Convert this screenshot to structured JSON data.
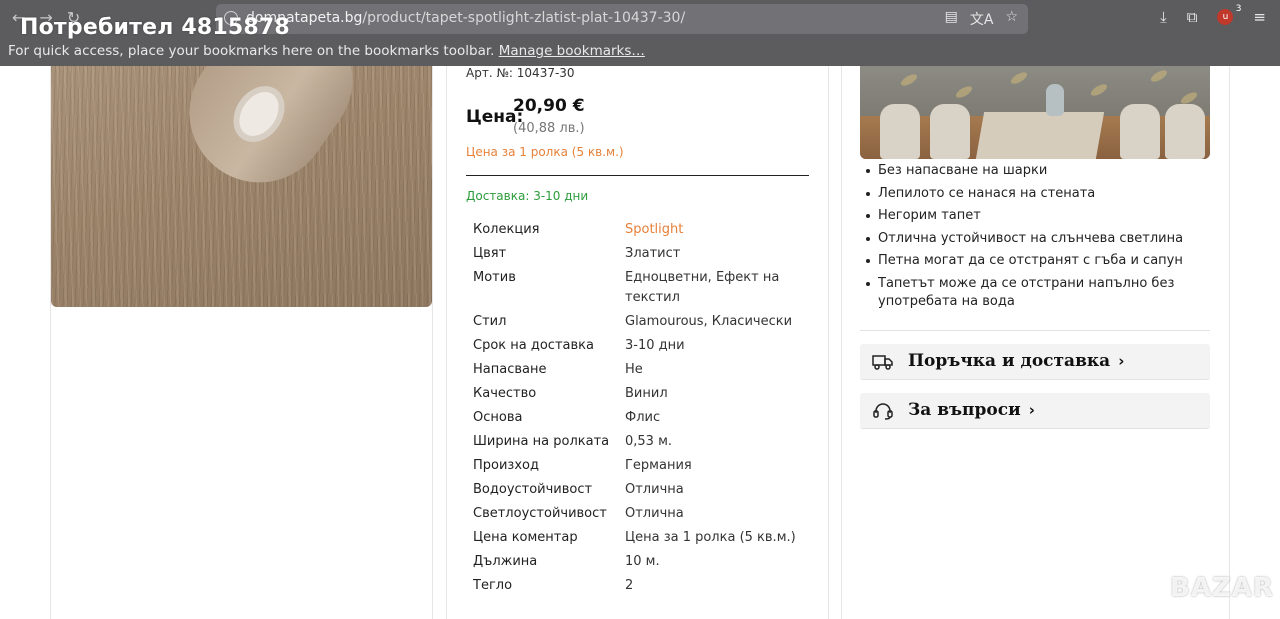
{
  "browser": {
    "user_overlay": "Потребител 4815878",
    "url_domain": "domnatapeta.bg",
    "url_path": "/product/tapet-spotlight-zlatist-plat-10437-30/",
    "bookmarks_hint": "For quick access, place your bookmarks here on the bookmarks toolbar.",
    "bookmarks_link": "Manage bookmarks…",
    "extension_count": "3"
  },
  "product": {
    "art_no": "Арт. №: 10437-30",
    "price_label": "Цена:",
    "price_eur": "20,90 €",
    "price_bgn": "(40,88 лв.)",
    "price_note": "Цена за 1 ролка (5 кв.м.)",
    "delivery": "Доставка: 3-10 дни",
    "specs": [
      {
        "key": "Колекция",
        "value": "Spotlight"
      },
      {
        "key": "Цвят",
        "value": "Златист"
      },
      {
        "key": "Мотив",
        "value": "Едноцветни, Ефект на текстил"
      },
      {
        "key": "Стил",
        "value": "Glamourous, Класически"
      },
      {
        "key": "Срок на доставка",
        "value": "3-10 дни"
      },
      {
        "key": "Напасване",
        "value": "Не"
      },
      {
        "key": "Качество",
        "value": "Винил"
      },
      {
        "key": "Основа",
        "value": "Флис"
      },
      {
        "key": "Ширина на ролката",
        "value": "0,53 м."
      },
      {
        "key": "Произход",
        "value": "Германия"
      },
      {
        "key": "Водоустойчивост",
        "value": "Отлична"
      },
      {
        "key": "Светлоустойчивост",
        "value": "Отлична"
      },
      {
        "key": "Цена коментар",
        "value": "Цена за 1 ролка (5 кв.м.)"
      },
      {
        "key": "Дължина",
        "value": "10 м."
      },
      {
        "key": "Тегло",
        "value": "2"
      }
    ]
  },
  "features": [
    "Без напасване на шарки",
    "Лепилото се нанася на стената",
    "Негорим тапет",
    "Отлична устойчивост на слънчева светлина",
    "Петна могат да се отстранят с гъба и сапун",
    "Тапетът може да се отстрани напълно без употребата на вода"
  ],
  "accordions": {
    "order_delivery": "Поръчка и доставка",
    "questions": "За въпроси",
    "chevron": "›"
  },
  "watermark": "BAZAR",
  "colors": {
    "accent_orange": "#e6813a",
    "delivery_green": "#2e9c3c",
    "chrome_bg": "#5c5c5e"
  },
  "icons": {
    "back": "←",
    "forward": "→",
    "reload": "↻",
    "reader": "▤",
    "translate": "文A",
    "bookmark_star": "☆",
    "download": "⤓",
    "extensions": "⧉",
    "menu": "≡"
  }
}
